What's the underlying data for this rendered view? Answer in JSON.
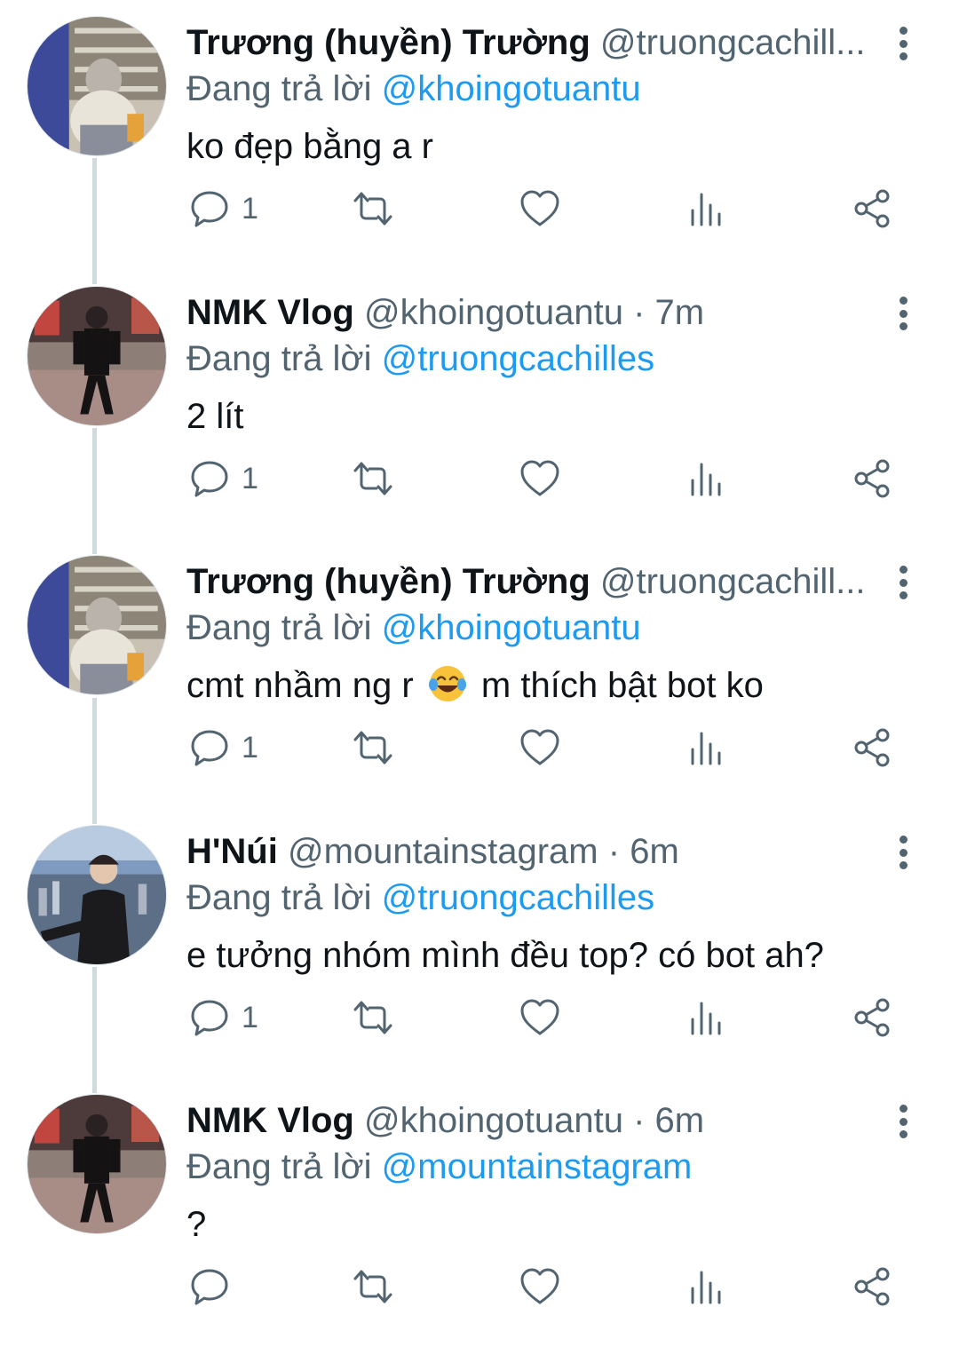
{
  "reply_prefix": "Đang trả lời",
  "colors": {
    "accent": "#1d9bf0",
    "muted": "#536471",
    "text": "#0f1419"
  },
  "tweets": [
    {
      "name": "Trương (huyền) Trường",
      "handle": "@truongcachill...",
      "time": "",
      "reply_to": "@khoingotuantu",
      "text": "ko đẹp bằng a r",
      "reply_count": "1",
      "avatar": "avatar-truong"
    },
    {
      "name": "NMK Vlog",
      "handle": "@khoingotuantu",
      "time": "7m",
      "reply_to": "@truongcachilles",
      "text": "2 lít",
      "reply_count": "1",
      "avatar": "avatar-nmk"
    },
    {
      "name": "Trương (huyền) Trường",
      "handle": "@truongcachill...",
      "time": "",
      "reply_to": "@khoingotuantu",
      "text_before": "cmt nhầm ng r",
      "text_emoji": "face-with-tears-of-joy",
      "text_after": "m thích bật bot ko",
      "reply_count": "1",
      "avatar": "avatar-truong"
    },
    {
      "name": "H'Núi",
      "handle": "@mountainstagram",
      "time": "6m",
      "reply_to": "@truongcachilles",
      "text": "e tưởng nhóm mình đều top? có bot ah?",
      "reply_count": "1",
      "avatar": "avatar-hnui"
    },
    {
      "name": "NMK Vlog",
      "handle": "@khoingotuantu",
      "time": "6m",
      "reply_to": "@mountainstagram",
      "text": "?",
      "reply_count": "",
      "avatar": "avatar-nmk"
    }
  ],
  "icons": [
    "reply-icon",
    "retweet-icon",
    "like-icon",
    "views-icon",
    "share-icon",
    "more-icon"
  ]
}
